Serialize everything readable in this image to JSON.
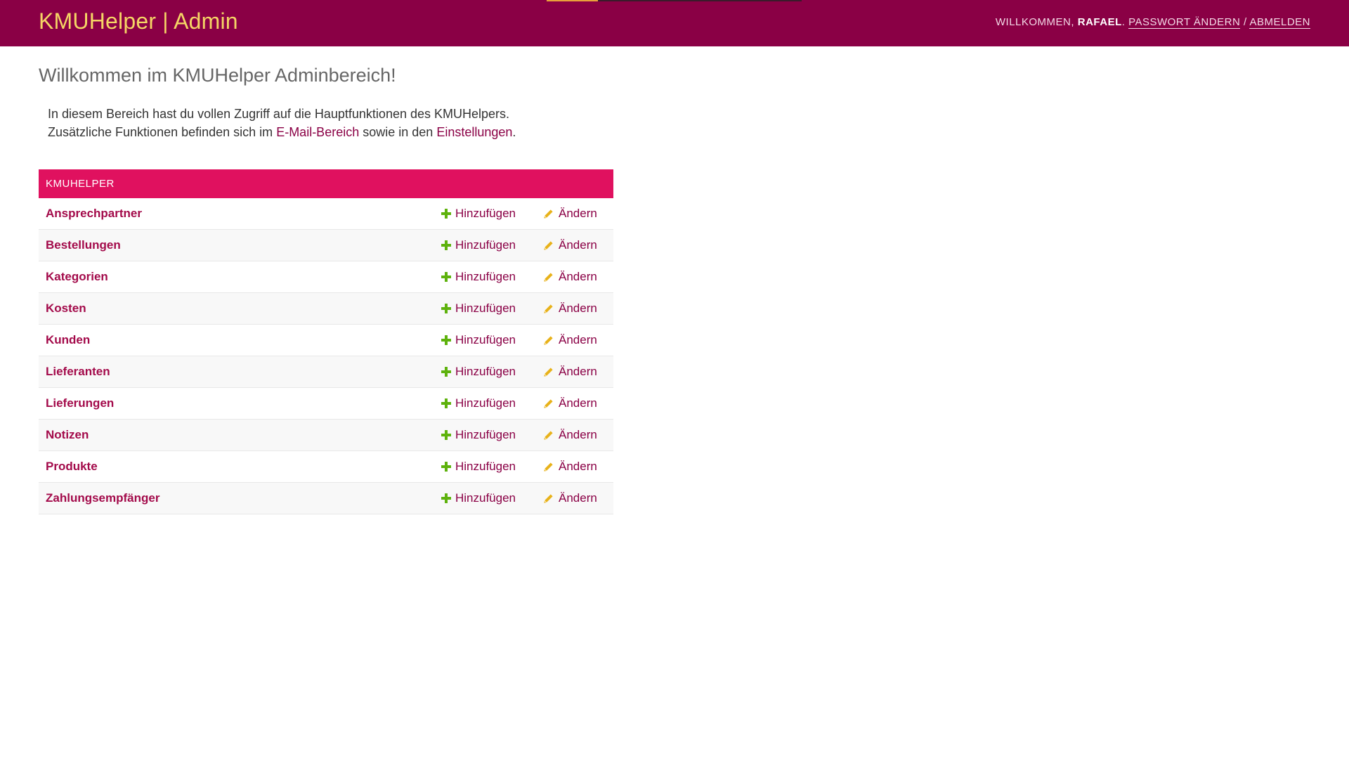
{
  "header": {
    "branding": "KMUHelper | Admin",
    "loading_progress": 0.2,
    "welcome_text": "Willkommen,",
    "username": "Rafael",
    "separator": "/",
    "change_password_label": "Passwort ändern",
    "logout_label": "Abmelden"
  },
  "main": {
    "title": "Willkommen im KMUHelper Adminbereich!",
    "intro_line1": "In diesem Bereich hast du vollen Zugriff auf die Hauptfunktionen des KMUHelpers.",
    "intro_line2_prefix": "Zusätzliche Funktionen befinden sich im",
    "email_link": "E-Mail-Bereich",
    "intro_line2_middle": "sowie in den",
    "settings_link": "Einstellungen",
    "intro_line2_suffix": "."
  },
  "module": {
    "caption": "KMUHelper",
    "add_label": "Hinzufügen",
    "change_label": "Ändern",
    "rows": [
      {
        "name": "Ansprechpartner"
      },
      {
        "name": "Bestellungen"
      },
      {
        "name": "Kategorien"
      },
      {
        "name": "Kosten"
      },
      {
        "name": "Kunden"
      },
      {
        "name": "Lieferanten"
      },
      {
        "name": "Lieferungen"
      },
      {
        "name": "Notizen"
      },
      {
        "name": "Produkte"
      },
      {
        "name": "Zahlungsempfänger"
      }
    ]
  },
  "colors": {
    "header_bg": "#8a0045",
    "branding": "#f5d565",
    "module_caption_bg": "#e0115f",
    "add_icon": "#5eb20d",
    "change_icon": "#e8b21a",
    "link": "#8a0045"
  },
  "icons": {
    "add": "plus-icon",
    "change": "pencil-icon"
  }
}
